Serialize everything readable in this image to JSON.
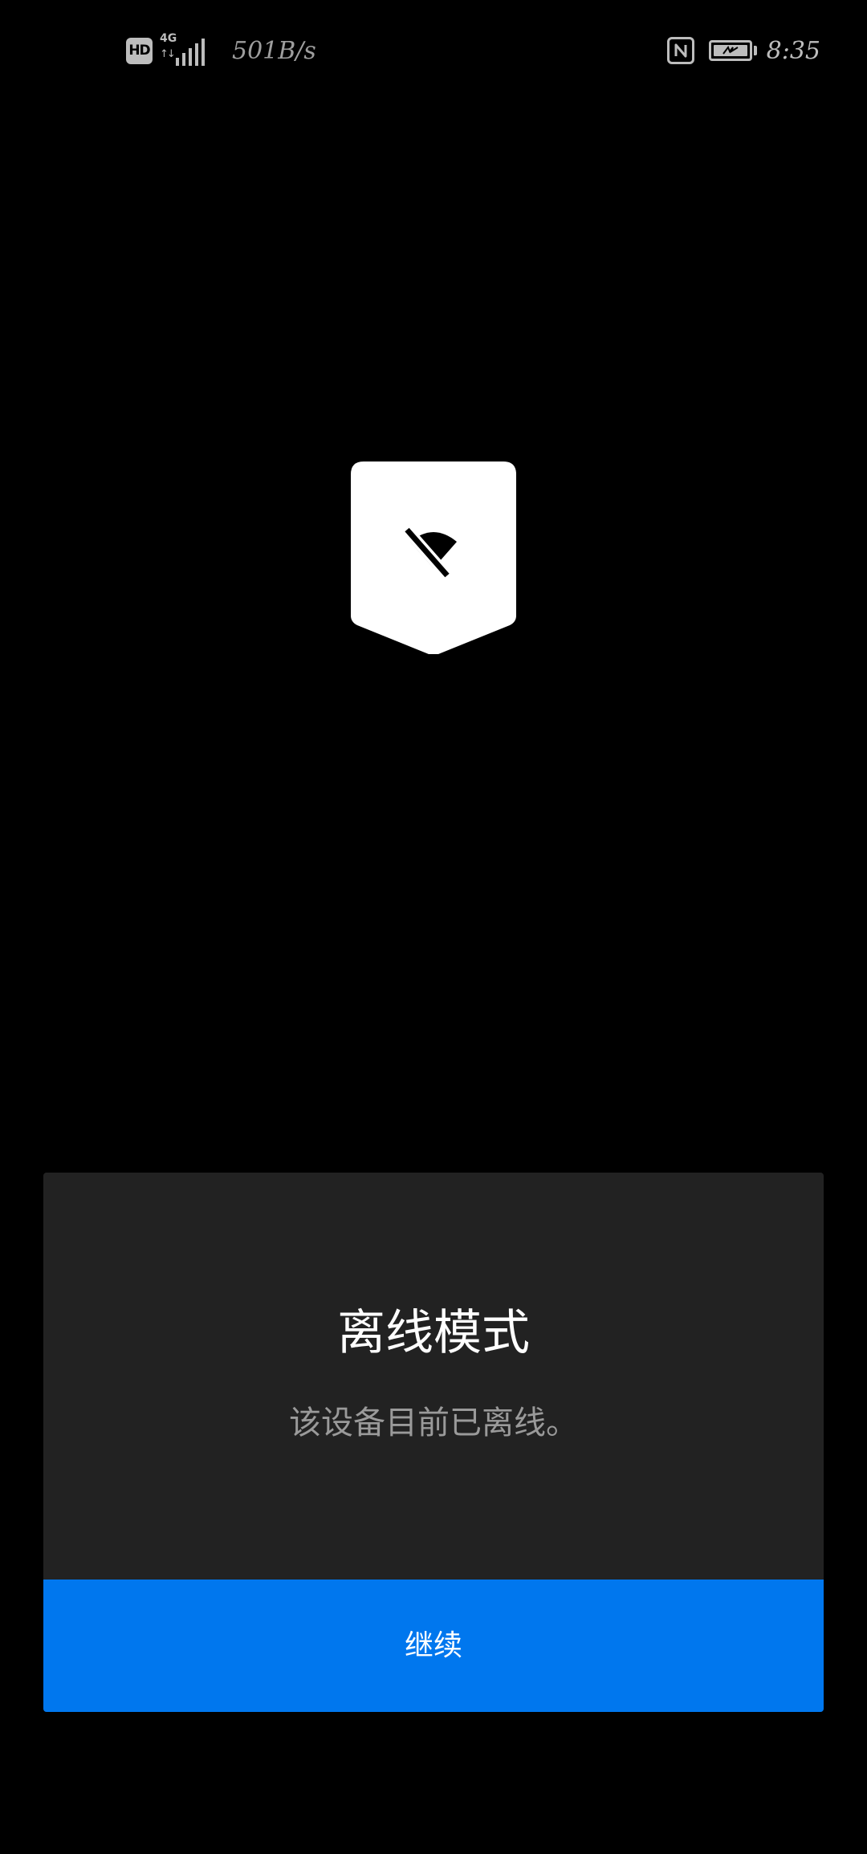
{
  "status_bar": {
    "hd_label": "HD",
    "network_type": "4G",
    "network_arrows": "↑↓",
    "net_speed": "501B/s",
    "time": "8:35",
    "icons": {
      "signal": "cell-signal-icon",
      "nfc": "nfc-icon",
      "battery": "battery-charging-icon"
    }
  },
  "badge": {
    "icon": "wifi-off-icon"
  },
  "dialog": {
    "title": "离线模式",
    "message": "该设备目前已离线。",
    "continue_label": "继续"
  },
  "colors": {
    "background": "#000000",
    "card": "#222222",
    "accent": "#0077ee",
    "message_text": "#9a9a9a"
  }
}
